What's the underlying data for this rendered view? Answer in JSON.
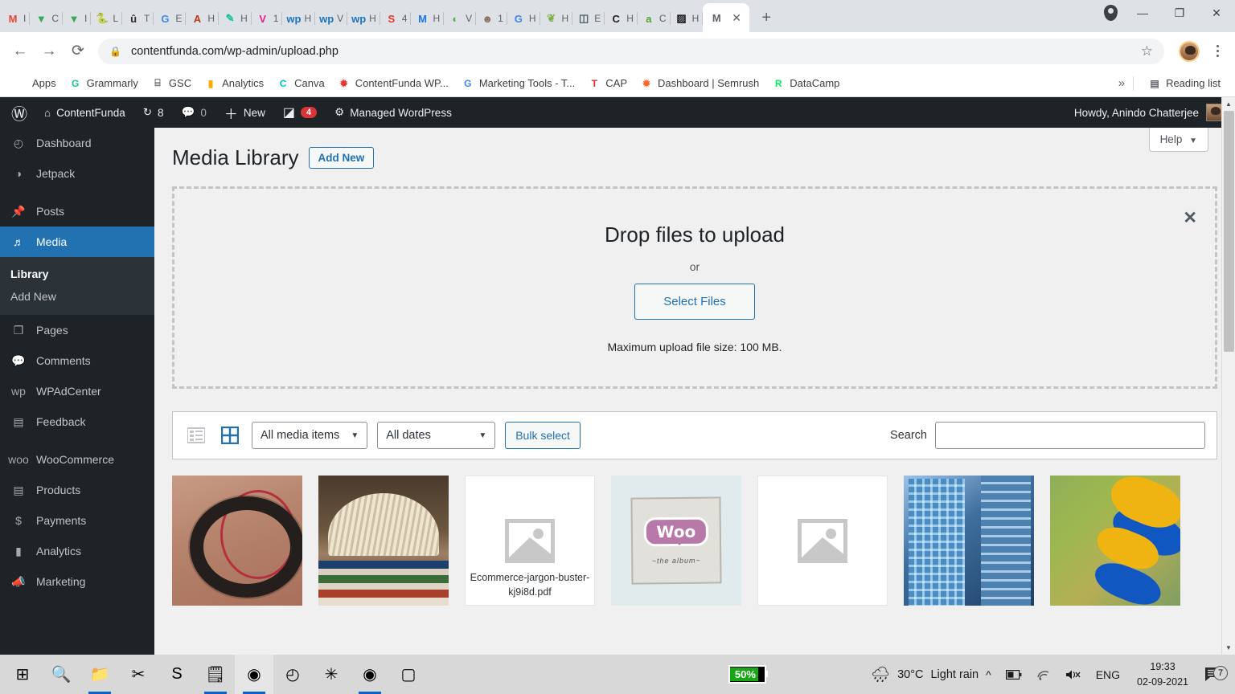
{
  "browser": {
    "tabs": [
      {
        "icon": "gmail-icon",
        "label": "I",
        "glyph": "M",
        "color": "#ea4335"
      },
      {
        "icon": "mailmeteor-icon",
        "label": "C",
        "glyph": "▼",
        "color": "#34a853"
      },
      {
        "icon": "mailmeteor-icon",
        "label": "I",
        "glyph": "▼",
        "color": "#34a853"
      },
      {
        "icon": "python-icon",
        "label": "L",
        "glyph": "🐍",
        "color": "#3776ab"
      },
      {
        "icon": "unbounce-icon",
        "label": "T",
        "glyph": "û",
        "color": "#2a2a2a"
      },
      {
        "icon": "google-icon",
        "label": "E",
        "glyph": "G",
        "color": "#4285f4"
      },
      {
        "icon": "ahrefs-icon",
        "label": "H",
        "glyph": "A",
        "color": "#b33a1a"
      },
      {
        "icon": "grammarly-icon",
        "label": "H",
        "glyph": "✎",
        "color": "#15c39a"
      },
      {
        "icon": "venngage-icon",
        "label": "1",
        "glyph": "V",
        "color": "#e91e8c"
      },
      {
        "icon": "wordpress-icon",
        "label": "H",
        "glyph": "wp",
        "color": "#1e73be"
      },
      {
        "icon": "wordpress-icon",
        "label": "V",
        "glyph": "wp",
        "color": "#1e73be"
      },
      {
        "icon": "wordpress-icon",
        "label": "H",
        "glyph": "wp",
        "color": "#1e73be"
      },
      {
        "icon": "semrush-icon",
        "label": "4",
        "glyph": "S",
        "color": "#e8352e"
      },
      {
        "icon": "gmail-icon",
        "label": "H",
        "glyph": "M",
        "color": "#1a73e8"
      },
      {
        "icon": "spinner-icon",
        "label": "V",
        "glyph": "◐",
        "color": "#4caf50"
      },
      {
        "icon": "face-icon",
        "label": "1",
        "glyph": "☻",
        "color": "#8d6e63"
      },
      {
        "icon": "google-icon",
        "label": "H",
        "glyph": "G",
        "color": "#4285f4"
      },
      {
        "icon": "leaf-icon",
        "label": "H",
        "glyph": "❦",
        "color": "#7cb342"
      },
      {
        "icon": "book-icon",
        "label": "E",
        "glyph": "◫",
        "color": "#455a64"
      },
      {
        "icon": "canva-icon",
        "label": "H",
        "glyph": "C",
        "color": "#1d1d1d"
      },
      {
        "icon": "amazon-icon",
        "label": "C",
        "glyph": "a",
        "color": "#5a9e28"
      },
      {
        "icon": "dark-icon",
        "label": "H",
        "glyph": "▨",
        "color": "#111111"
      }
    ],
    "active_tab": {
      "icon": "media-tab-icon",
      "label": "M",
      "close": "✕"
    },
    "new_tab_label": "+",
    "window_controls": {
      "minimize": "—",
      "maximize": "❐",
      "close": "✕"
    },
    "url": "contentfunda.com/wp-admin/upload.php",
    "back_label": "←",
    "forward_label": "→",
    "reload_label": "⟳",
    "lock_label": "🔒",
    "star_label": "☆",
    "bookmarks": [
      {
        "label": "Apps",
        "icon": "apps-grid-icon"
      },
      {
        "label": "Grammarly",
        "icon": "grammarly-icon",
        "glyph": "G",
        "color": "#15c39a"
      },
      {
        "label": "GSC",
        "icon": "search-console-icon",
        "glyph": "⌸",
        "color": "#5f6368"
      },
      {
        "label": "Analytics",
        "icon": "google-analytics-icon",
        "glyph": "▮",
        "color": "#f9ab00"
      },
      {
        "label": "Canva",
        "icon": "canva-icon",
        "glyph": "C",
        "color": "#00c4cc"
      },
      {
        "label": "ContentFunda WP...",
        "icon": "wordpress-icon",
        "glyph": "✹",
        "color": "#e8352e"
      },
      {
        "label": "Marketing Tools - T...",
        "icon": "google-icon",
        "glyph": "G",
        "color": "#4285f4"
      },
      {
        "label": "CAP",
        "icon": "text-icon",
        "glyph": "T",
        "color": "#d93025"
      },
      {
        "label": "Dashboard | Semrush",
        "icon": "semrush-icon",
        "glyph": "✹",
        "color": "#ff642d"
      },
      {
        "label": "DataCamp",
        "icon": "datacamp-icon",
        "glyph": "R",
        "color": "#03ef62"
      }
    ],
    "overflow_label": "»",
    "reading_list_label": "Reading list",
    "reading_list_icon": "reading-list-icon"
  },
  "adminbar": {
    "wp_logo": "wordpress-logo-icon",
    "site_name": "ContentFunda",
    "site_icon": "home-icon",
    "updates_count": "8",
    "updates_icon": "updates-icon",
    "comments_count": "0",
    "comments_icon": "comment-icon",
    "new_label": "New",
    "new_icon": "plus-icon",
    "jetpack_icon": "jetpack-icon",
    "jetpack_count": "4",
    "managed_label": "Managed WordPress",
    "managed_icon": "gear-icon",
    "howdy": "Howdy, Anindo Chatterjee"
  },
  "sidebar": {
    "items": [
      {
        "label": "Dashboard",
        "icon": "dashboard-icon",
        "glyph": "◴",
        "current": false
      },
      {
        "label": "Jetpack",
        "icon": "jetpack-icon",
        "glyph": "◑",
        "current": false
      },
      {
        "sep": true
      },
      {
        "label": "Posts",
        "icon": "pin-icon",
        "glyph": "📌",
        "current": false
      },
      {
        "label": "Media",
        "icon": "media-icon",
        "glyph": "♬",
        "current": true
      }
    ],
    "submenu": [
      {
        "label": "Library",
        "current": true
      },
      {
        "label": "Add New",
        "current": false
      }
    ],
    "items_after": [
      {
        "label": "Pages",
        "icon": "pages-icon",
        "glyph": "❐"
      },
      {
        "label": "Comments",
        "icon": "comment-icon",
        "glyph": "💬"
      },
      {
        "label": "WPAdCenter",
        "icon": "wpadcenter-icon",
        "glyph": "wp"
      },
      {
        "label": "Feedback",
        "icon": "feedback-icon",
        "glyph": "▤"
      },
      {
        "sep": true
      },
      {
        "label": "WooCommerce",
        "icon": "woocommerce-icon",
        "glyph": "woo"
      },
      {
        "label": "Products",
        "icon": "products-icon",
        "glyph": "▤"
      },
      {
        "label": "Payments",
        "icon": "payments-icon",
        "glyph": "$"
      },
      {
        "label": "Analytics",
        "icon": "analytics-icon",
        "glyph": "▮"
      },
      {
        "label": "Marketing",
        "icon": "marketing-icon",
        "glyph": "📣"
      }
    ]
  },
  "main": {
    "help_label": "Help",
    "help_caret": "▼",
    "page_title": "Media Library",
    "add_new_label": "Add New",
    "dropzone": {
      "title": "Drop files to upload",
      "or": "or",
      "select_files_label": "Select Files",
      "max_size": "Maximum upload file size: 100 MB.",
      "close_label": "✕"
    },
    "toolbar": {
      "list_view_icon": "list-view-icon",
      "grid_view_icon": "grid-view-icon",
      "media_filter_value": "All media items",
      "date_filter_value": "All dates",
      "bulk_select_label": "Bulk select",
      "search_label": "Search",
      "search_value": "",
      "search_placeholder": ""
    },
    "media_items": [
      {
        "type": "photo",
        "art": "ph-headphones",
        "name": "headphones"
      },
      {
        "type": "photo",
        "art": "ph-books",
        "name": "open-book"
      },
      {
        "type": "document",
        "filename": "Ecommerce-jargon-buster-kj9i8d.pdf"
      },
      {
        "type": "woo",
        "woo_text": "Woo",
        "woo_sub": "~the album~"
      },
      {
        "type": "blank"
      },
      {
        "type": "photo",
        "art": "ph-city",
        "name": "skyscrapers"
      },
      {
        "type": "photo",
        "art": "ph-kayak",
        "name": "kayaks"
      }
    ]
  },
  "taskbar": {
    "items": [
      {
        "icon": "windows-start-icon",
        "glyph": "⊞",
        "open": false,
        "active": false
      },
      {
        "icon": "search-icon",
        "glyph": "🔍",
        "open": false,
        "active": false
      },
      {
        "icon": "file-explorer-icon",
        "glyph": "📁",
        "open": true,
        "active": false
      },
      {
        "icon": "snipping-tool-icon",
        "glyph": "✂",
        "open": false,
        "active": false
      },
      {
        "icon": "skype-icon",
        "glyph": "S",
        "open": false,
        "active": false
      },
      {
        "icon": "notepad-icon",
        "glyph": "🗒",
        "open": true,
        "active": false
      },
      {
        "icon": "chrome-icon",
        "glyph": "◉",
        "open": true,
        "active": true
      },
      {
        "icon": "clock-app-icon",
        "glyph": "◴",
        "open": false,
        "active": false
      },
      {
        "icon": "slack-icon",
        "glyph": "✳",
        "open": false,
        "active": false
      },
      {
        "icon": "chrome-profile-icon",
        "glyph": "◉",
        "open": true,
        "active": false
      },
      {
        "icon": "messages-icon",
        "glyph": "▢",
        "open": false,
        "active": false
      }
    ],
    "battery_percent": "50%",
    "weather_icon": "rain-cloud-icon",
    "weather_temp": "30°C",
    "weather_desc": "Light rain",
    "chevron_up": "^",
    "battery_icon": "battery-icon",
    "wifi_icon": "wifi-icon",
    "volume_icon": "volume-muted-icon",
    "language": "ENG",
    "time": "19:33",
    "date": "02-09-2021",
    "notification_icon": "notification-icon",
    "notification_count": "7"
  }
}
